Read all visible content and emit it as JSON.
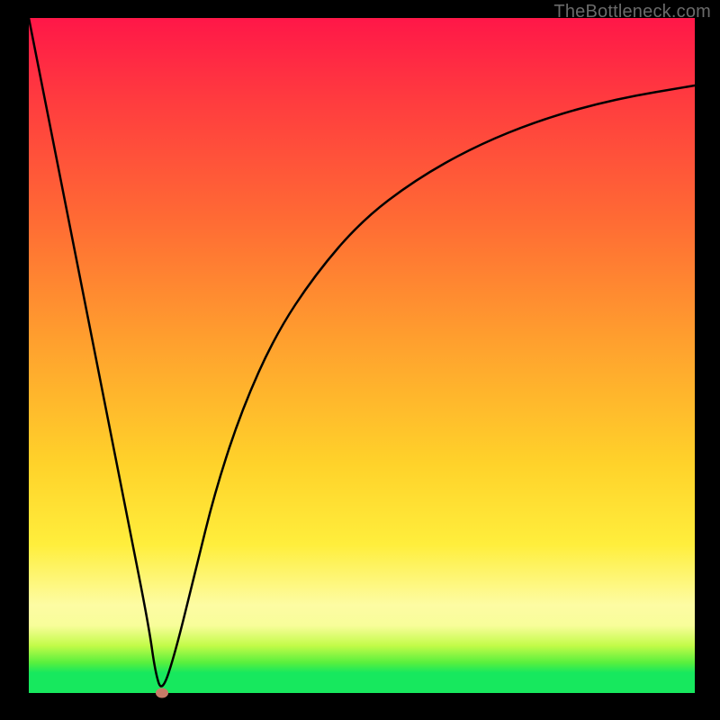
{
  "watermark": "TheBottleneck.com",
  "chart_data": {
    "type": "line",
    "title": "",
    "xlabel": "",
    "ylabel": "",
    "xlim": [
      0,
      100
    ],
    "ylim": [
      0,
      100
    ],
    "grid": false,
    "legend": false,
    "background_gradient": {
      "direction": "vertical",
      "stops": [
        {
          "pos": 0.0,
          "color": "#ff1748"
        },
        {
          "pos": 0.12,
          "color": "#ff3b3f"
        },
        {
          "pos": 0.3,
          "color": "#ff6b34"
        },
        {
          "pos": 0.48,
          "color": "#ffa02e"
        },
        {
          "pos": 0.66,
          "color": "#ffd22a"
        },
        {
          "pos": 0.78,
          "color": "#ffee3c"
        },
        {
          "pos": 0.87,
          "color": "#fdfca3"
        },
        {
          "pos": 0.93,
          "color": "#c2fb48"
        },
        {
          "pos": 0.96,
          "color": "#59f03e"
        },
        {
          "pos": 0.98,
          "color": "#17e85e"
        },
        {
          "pos": 1.0,
          "color": "#17e85e"
        }
      ]
    },
    "series": [
      {
        "name": "bottleneck-curve",
        "color": "#000000",
        "stroke_width": 2.5,
        "x": [
          0,
          5,
          10,
          15,
          18,
          19,
          20,
          22,
          25,
          28,
          32,
          37,
          43,
          50,
          58,
          67,
          77,
          88,
          100
        ],
        "y": [
          100,
          75,
          50,
          25,
          10,
          3,
          0,
          6,
          18,
          30,
          42,
          53,
          62,
          70,
          76,
          81,
          85,
          88,
          90
        ]
      }
    ],
    "marker": {
      "name": "optimal-point",
      "x": 20,
      "y": 0,
      "color": "#c77b68"
    }
  }
}
